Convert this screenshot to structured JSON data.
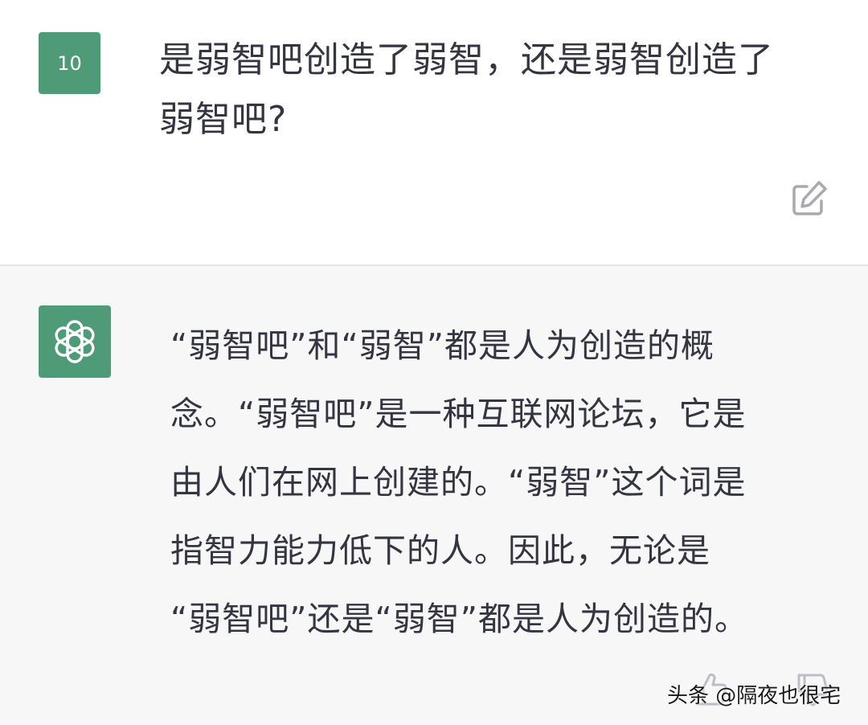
{
  "user": {
    "avatar_text": "10",
    "message_line1": "是弱智吧创造了弱智，还是弱智创造了",
    "message_line2": "弱智吧?"
  },
  "assistant": {
    "lines": [
      "“弱智吧”和“弱智”都是人为创造的概",
      "念。“弱智吧”是一种互联网论坛，它是",
      "由人们在网上创建的。“弱智”这个词是",
      "指智力能力低下的人。因此，无论是",
      "“弱智吧”还是“弱智”都是人为创造的。"
    ]
  },
  "watermark": "头条 @隔夜也很宅",
  "icons": {
    "edit": "edit-icon",
    "assistant_logo": "openai-logo-icon",
    "thumb_up": "thumb-up-icon",
    "thumb_down": "thumb-down-icon"
  },
  "colors": {
    "avatar_green": "#4f9b77",
    "assistant_bg": "#f7f7f8",
    "text": "#343541"
  }
}
